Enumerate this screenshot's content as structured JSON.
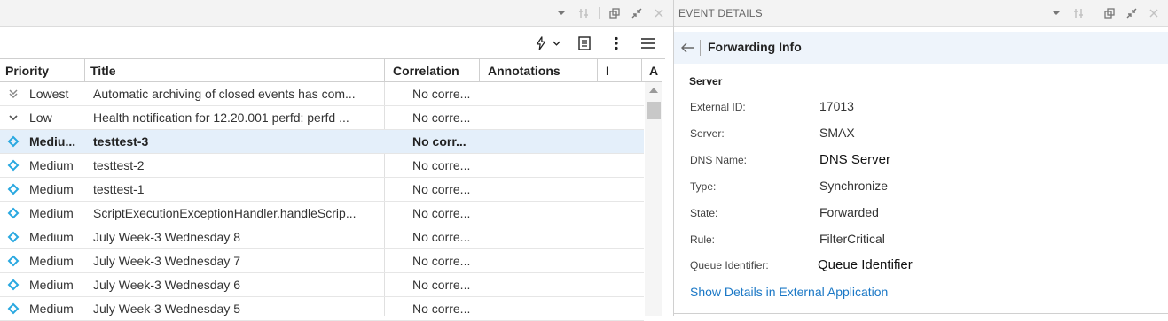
{
  "left_pane": {
    "title_icons": [
      "chevron-down-icon",
      "filter-settings-icon",
      "undock-icon",
      "collapse-icon",
      "close-icon"
    ]
  },
  "toolbar": {
    "icons": [
      "lightning-icon",
      "chevron-down-icon",
      "column-chooser-icon",
      "more-vertical-icon",
      "menu-icon"
    ]
  },
  "table": {
    "columns": [
      "Priority",
      "Title",
      "Correlation",
      "Annotations",
      "I",
      "A"
    ],
    "rows": [
      {
        "priority": "Lowest",
        "icon": "double-chevron-down-icon",
        "title": "Automatic archiving of closed events has com...",
        "correlation": "No corre...",
        "selected": false
      },
      {
        "priority": "Low",
        "icon": "chevron-down-icon",
        "title": "Health notification for 12.20.001 perfd: perfd ...",
        "correlation": "No corre...",
        "selected": false
      },
      {
        "priority": "Mediu...",
        "icon": "diamond-icon",
        "title": "testtest-3",
        "correlation": "No corr...",
        "selected": true
      },
      {
        "priority": "Medium",
        "icon": "diamond-icon",
        "title": "testtest-2",
        "correlation": "No corre...",
        "selected": false
      },
      {
        "priority": "Medium",
        "icon": "diamond-icon",
        "title": "testtest-1",
        "correlation": "No corre...",
        "selected": false
      },
      {
        "priority": "Medium",
        "icon": "diamond-icon",
        "title": "ScriptExecutionExceptionHandler.handleScrip...",
        "correlation": "No corre...",
        "selected": false
      },
      {
        "priority": "Medium",
        "icon": "diamond-icon",
        "title": "July Week-3 Wednesday 8",
        "correlation": "No corre...",
        "selected": false
      },
      {
        "priority": "Medium",
        "icon": "diamond-icon",
        "title": "July Week-3 Wednesday 7",
        "correlation": "No corre...",
        "selected": false
      },
      {
        "priority": "Medium",
        "icon": "diamond-icon",
        "title": "July Week-3 Wednesday 6",
        "correlation": "No corre...",
        "selected": false
      },
      {
        "priority": "Medium",
        "icon": "diamond-icon",
        "title": "July Week-3 Wednesday 5",
        "correlation": "No corre...",
        "selected": false
      }
    ]
  },
  "right_pane": {
    "title": "EVENT DETAILS",
    "detail_title": "Forwarding Info",
    "section": "Server",
    "fields": [
      {
        "label": "External ID:",
        "value": "17013"
      },
      {
        "label": "Server:",
        "value": "SMAX"
      },
      {
        "label": "DNS Name:",
        "value": "DNS Server"
      },
      {
        "label": "Type:",
        "value": "Synchronize"
      },
      {
        "label": "State:",
        "value": "Forwarded"
      },
      {
        "label": "Rule:",
        "value": "FilterCritical"
      },
      {
        "label": "Queue Identifier:",
        "value": "Queue Identifier"
      }
    ],
    "link": "Show Details in External Application"
  },
  "colors": {
    "accent": "#1b78c6",
    "diamond": "#29a8e0",
    "selected_row": "#e4effa"
  }
}
